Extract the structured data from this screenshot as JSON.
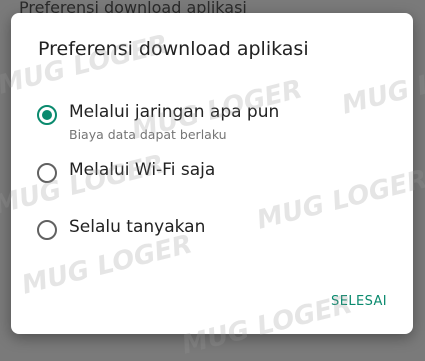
{
  "background": {
    "peek_title": "Preferensi download aplikasi"
  },
  "dialog": {
    "title": "Preferensi download aplikasi",
    "options": [
      {
        "label": "Melalui jaringan apa pun",
        "sublabel": "Biaya data dapat berlaku",
        "selected": true
      },
      {
        "label": "Melalui Wi-Fi saja",
        "selected": false
      },
      {
        "label": "Selalu tanyakan",
        "selected": false
      }
    ],
    "action_label": "SELESAI"
  },
  "watermark": {
    "text": "MUG LOGER"
  },
  "colors": {
    "accent": "#0a8a6e",
    "scrim": "#7a7a7a",
    "dialog_bg": "#ffffff",
    "text_primary": "#222222",
    "text_secondary": "#757575"
  }
}
